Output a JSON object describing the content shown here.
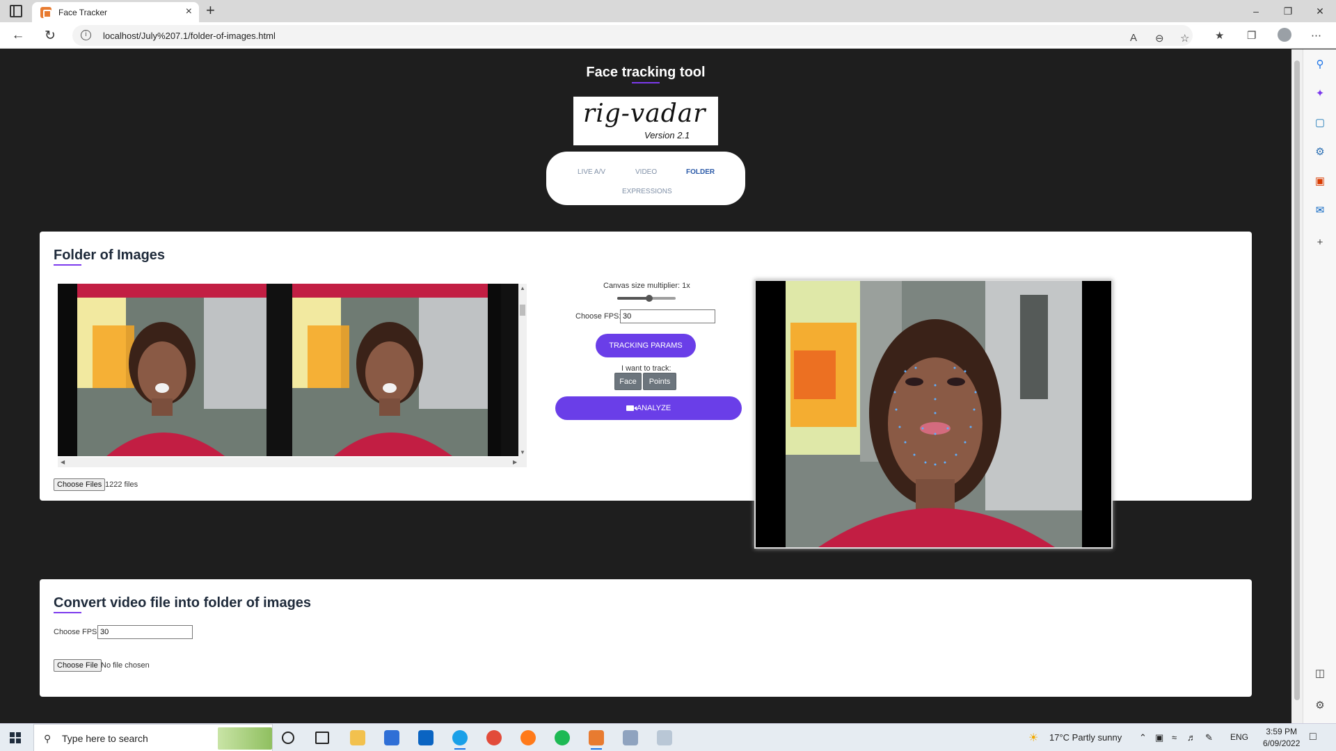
{
  "browser": {
    "tab_title": "Face Tracker",
    "url": "localhost/July%207.1/folder-of-images.html",
    "minimize_glyph": "–",
    "restore_glyph": "❐",
    "close_glyph": "✕"
  },
  "page": {
    "title": "Face tracking tool",
    "logo_text": "rig-vadar",
    "logo_version": "Version 2.1",
    "nav": [
      "LIVE A/V",
      "VIDEO",
      "FOLDER",
      "EXPRESSIONS"
    ],
    "nav_active": "FOLDER"
  },
  "folder_card": {
    "title": "Folder of Images",
    "choose_files_label": "Choose Files",
    "files_count": "1222 files",
    "canvas_label": "Canvas size multiplier: 1x",
    "canvas_slider_value": 0.55,
    "fps_label": "Choose FPS:",
    "fps_value": "30",
    "tracking_params_label": "TRACKING PARAMS",
    "track_label": "I want to track:",
    "face_label": "Face",
    "points_label": "Points",
    "analyze_label": "ANALYZE"
  },
  "convert_card": {
    "title": "Convert video file into folder of images",
    "fps_label": "Choose FPS:",
    "fps_value": "30",
    "choose_file_label": "Choose File",
    "no_file_label": "No file chosen"
  },
  "taskbar": {
    "search_placeholder": "Type here to search",
    "weather": "17°C  Partly sunny",
    "language": "ENG",
    "time": "3:59 PM",
    "date": "6/09/2022"
  },
  "colors": {
    "accent": "#6a3ee8",
    "page_bg": "#1e1e1e",
    "card_bg": "#ffffff"
  }
}
